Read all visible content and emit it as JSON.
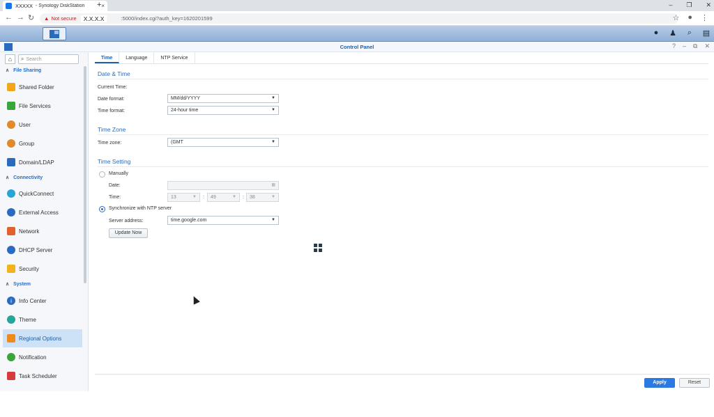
{
  "browser": {
    "tab_title_host": "XXXXX",
    "tab_title_rest": "- Synology DiskStation",
    "tab_close": "×",
    "new_tab": "+",
    "win_min": "–",
    "win_max": "❐",
    "win_close": "✕",
    "security_label": "Not secure",
    "host": "X.X.X.X",
    "path": ":5000/index.cgi?auth_key=1620201599"
  },
  "window": {
    "title": "Control Panel",
    "help": "?",
    "minimize": "–",
    "restore": "⧉",
    "close": "✕"
  },
  "sidebar": {
    "search_placeholder": "Search",
    "sections": [
      {
        "label": "File Sharing"
      },
      {
        "label": "Connectivity"
      },
      {
        "label": "System"
      }
    ],
    "items": [
      {
        "label": "Shared Folder",
        "color": "#f2a71b"
      },
      {
        "label": "File Services",
        "color": "#3aa53a"
      },
      {
        "label": "User",
        "color": "#e08a2d"
      },
      {
        "label": "Group",
        "color": "#e08a2d"
      },
      {
        "label": "Domain/LDAP",
        "color": "#2a6bbf"
      },
      {
        "label": "QuickConnect",
        "color": "#27a6d6"
      },
      {
        "label": "External Access",
        "color": "#2a6bbf"
      },
      {
        "label": "Network",
        "color": "#e0622d"
      },
      {
        "label": "DHCP Server",
        "color": "#2a6bbf"
      },
      {
        "label": "Security",
        "color": "#f2b31b"
      },
      {
        "label": "Info Center",
        "color": "#2a6bbf"
      },
      {
        "label": "Theme",
        "color": "#26a69a"
      },
      {
        "label": "Regional Options",
        "color": "#f08a1b"
      },
      {
        "label": "Notification",
        "color": "#3aa53a"
      },
      {
        "label": "Task Scheduler",
        "color": "#d63a3a"
      }
    ]
  },
  "tabs": [
    "Time",
    "Language",
    "NTP Service"
  ],
  "date_time": {
    "heading": "Date & Time",
    "current_time_label": "Current Time:",
    "date_format_label": "Date format:",
    "date_format_value": "MM/dd/YYYY",
    "time_format_label": "Time format:",
    "time_format_value": "24-hour time"
  },
  "time_zone": {
    "heading": "Time Zone",
    "label": "Time zone:",
    "value": "(GMT"
  },
  "time_setting": {
    "heading": "Time Setting",
    "manually_label": "Manually",
    "date_label": "Date:",
    "date_value": "",
    "time_label": "Time:",
    "hour": "13",
    "minute": "49",
    "second": "38",
    "sync_label": "Synchronize with NTP server",
    "server_label": "Server address:",
    "server_value": "time.google.com",
    "update_button": "Update Now"
  },
  "footer": {
    "apply": "Apply",
    "reset": "Reset"
  }
}
